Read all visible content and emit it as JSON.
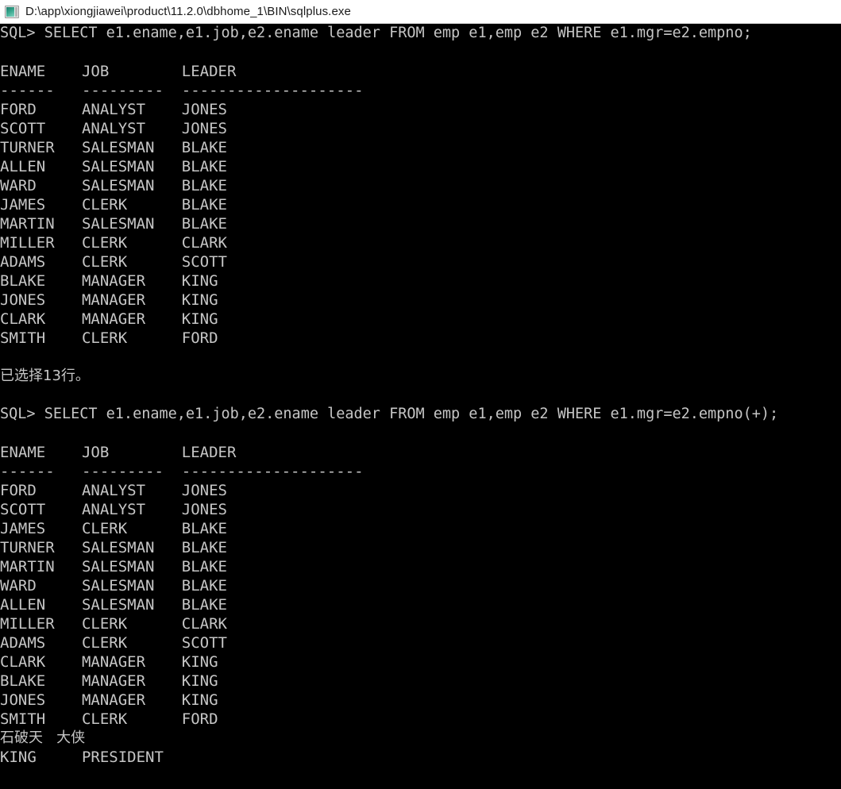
{
  "window": {
    "title": "D:\\app\\xiongjiawei\\product\\11.2.0\\dbhome_1\\BIN\\sqlplus.exe",
    "icon": "console-window-icon",
    "background_color": "#000000",
    "text_color": "#c6c6c6",
    "titlebar_color": "#ffffff"
  },
  "console": {
    "prompt": "SQL>",
    "blocks": [
      {
        "id": "query-1",
        "command": "SQL> SELECT e1.ename,e1.job,e2.ename leader FROM emp e1,emp e2 WHERE e1.mgr=e2.empno;",
        "headers": [
          "ENAME",
          "JOB",
          "LEADER"
        ],
        "header_line": "ENAME    JOB        LEADER",
        "separator_line": "------   ---------  --------------------",
        "separators": [
          "------",
          "---------",
          "--------------------"
        ],
        "rows": [
          [
            "FORD",
            "ANALYST",
            "JONES"
          ],
          [
            "SCOTT",
            "ANALYST",
            "JONES"
          ],
          [
            "TURNER",
            "SALESMAN",
            "BLAKE"
          ],
          [
            "ALLEN",
            "SALESMAN",
            "BLAKE"
          ],
          [
            "WARD",
            "SALESMAN",
            "BLAKE"
          ],
          [
            "JAMES",
            "CLERK",
            "BLAKE"
          ],
          [
            "MARTIN",
            "SALESMAN",
            "BLAKE"
          ],
          [
            "MILLER",
            "CLERK",
            "CLARK"
          ],
          [
            "ADAMS",
            "CLERK",
            "SCOTT"
          ],
          [
            "BLAKE",
            "MANAGER",
            "KING"
          ],
          [
            "JONES",
            "MANAGER",
            "KING"
          ],
          [
            "CLARK",
            "MANAGER",
            "KING"
          ],
          [
            "SMITH",
            "CLERK",
            "FORD"
          ]
        ],
        "row_lines": [
          "FORD     ANALYST    JONES",
          "SCOTT    ANALYST    JONES",
          "TURNER   SALESMAN   BLAKE",
          "ALLEN    SALESMAN   BLAKE",
          "WARD     SALESMAN   BLAKE",
          "JAMES    CLERK      BLAKE",
          "MARTIN   SALESMAN   BLAKE",
          "MILLER   CLERK      CLARK",
          "ADAMS    CLERK      SCOTT",
          "BLAKE    MANAGER    KING",
          "JONES    MANAGER    KING",
          "CLARK    MANAGER    KING",
          "SMITH    CLERK      FORD"
        ],
        "footer": "已选择13行。",
        "row_count": 13
      },
      {
        "id": "query-2",
        "command": "SQL> SELECT e1.ename,e1.job,e2.ename leader FROM emp e1,emp e2 WHERE e1.mgr=e2.empno(+);",
        "headers": [
          "ENAME",
          "JOB",
          "LEADER"
        ],
        "header_line": "ENAME    JOB        LEADER",
        "separator_line": "------   ---------  --------------------",
        "separators": [
          "------",
          "---------",
          "--------------------"
        ],
        "rows": [
          [
            "FORD",
            "ANALYST",
            "JONES"
          ],
          [
            "SCOTT",
            "ANALYST",
            "JONES"
          ],
          [
            "JAMES",
            "CLERK",
            "BLAKE"
          ],
          [
            "TURNER",
            "SALESMAN",
            "BLAKE"
          ],
          [
            "MARTIN",
            "SALESMAN",
            "BLAKE"
          ],
          [
            "WARD",
            "SALESMAN",
            "BLAKE"
          ],
          [
            "ALLEN",
            "SALESMAN",
            "BLAKE"
          ],
          [
            "MILLER",
            "CLERK",
            "CLARK"
          ],
          [
            "ADAMS",
            "CLERK",
            "SCOTT"
          ],
          [
            "CLARK",
            "MANAGER",
            "KING"
          ],
          [
            "BLAKE",
            "MANAGER",
            "KING"
          ],
          [
            "JONES",
            "MANAGER",
            "KING"
          ],
          [
            "SMITH",
            "CLERK",
            "FORD"
          ],
          [
            "石破天",
            "大侠",
            ""
          ],
          [
            "KING",
            "PRESIDENT",
            ""
          ]
        ],
        "row_lines": [
          "FORD     ANALYST    JONES",
          "SCOTT    ANALYST    JONES",
          "JAMES    CLERK      BLAKE",
          "TURNER   SALESMAN   BLAKE",
          "MARTIN   SALESMAN   BLAKE",
          "WARD     SALESMAN   BLAKE",
          "ALLEN    SALESMAN   BLAKE",
          "MILLER   CLERK      CLARK",
          "ADAMS    CLERK      SCOTT",
          "CLARK    MANAGER    KING",
          "BLAKE    MANAGER    KING",
          "JONES    MANAGER    KING",
          "SMITH    CLERK      FORD",
          "石破天   大侠",
          "KING     PRESIDENT"
        ]
      }
    ]
  }
}
